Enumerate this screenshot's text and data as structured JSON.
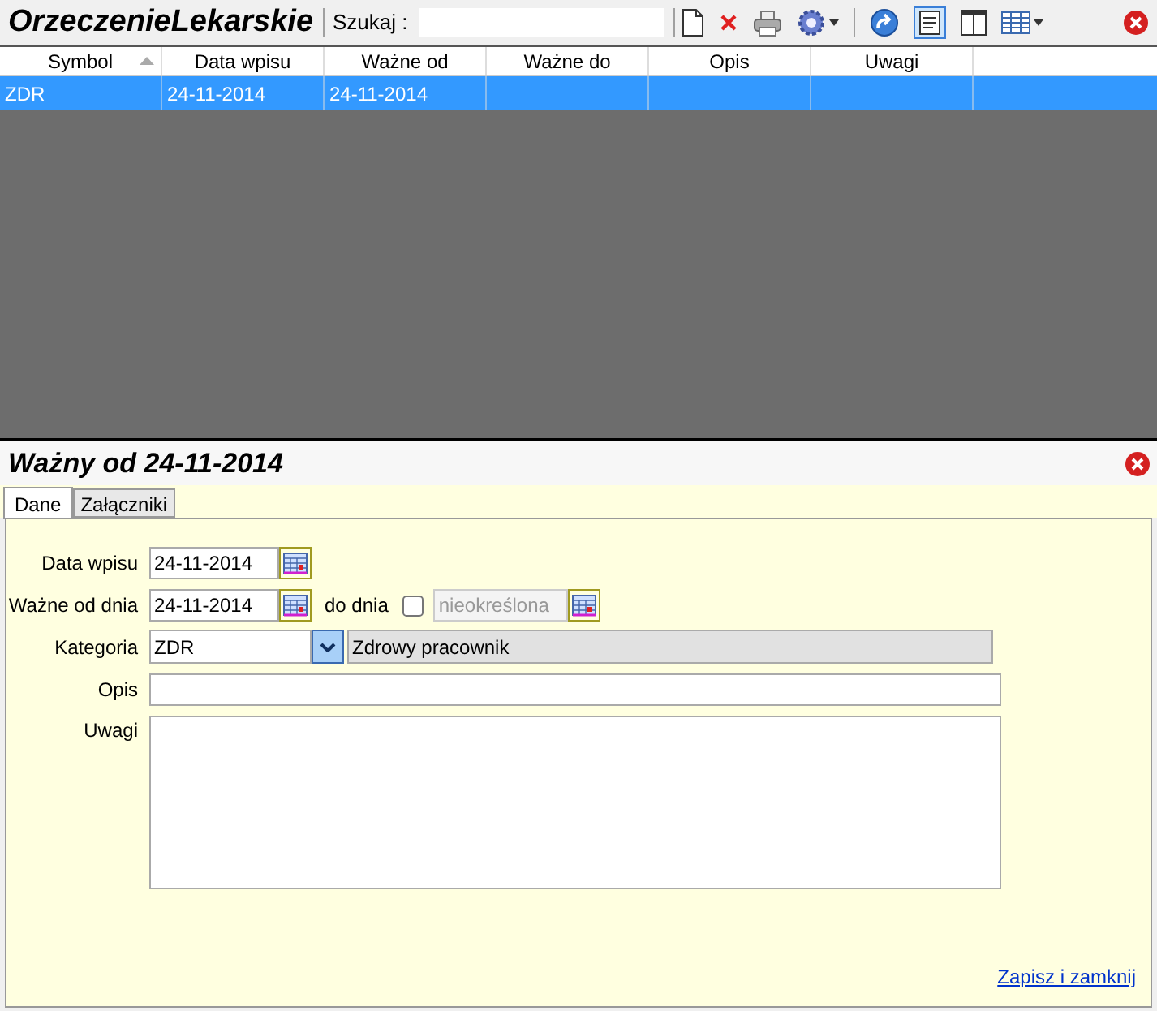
{
  "toolbar": {
    "title": "OrzeczenieLekarskie",
    "search_label": "Szukaj  :"
  },
  "table": {
    "columns": [
      {
        "label": "Symbol",
        "sorted": true
      },
      {
        "label": "Data wpisu",
        "sorted": false
      },
      {
        "label": "Ważne od",
        "sorted": false
      },
      {
        "label": "Ważne do",
        "sorted": false
      },
      {
        "label": "Opis",
        "sorted": false
      },
      {
        "label": "Uwagi",
        "sorted": false
      }
    ],
    "rows": [
      {
        "selected": true,
        "cells": [
          "ZDR",
          "24-11-2014",
          "24-11-2014",
          "",
          "",
          ""
        ]
      }
    ]
  },
  "detail": {
    "title": "Ważny od 24-11-2014",
    "tabs": [
      {
        "label": "Dane",
        "selected": true
      },
      {
        "label": "Załączniki",
        "selected": false
      }
    ],
    "form": {
      "data_wpisu": {
        "label": "Data wpisu",
        "value": "24-11-2014"
      },
      "wazne_od": {
        "label": "Ważne od dnia",
        "value": "24-11-2014"
      },
      "do_dnia": {
        "label": "do dnia",
        "checked": false,
        "value": "nieokreślona",
        "disabled": true
      },
      "kategoria": {
        "label": "Kategoria",
        "value": "ZDR",
        "description": "Zdrowy pracownik"
      },
      "opis": {
        "label": "Opis"
      },
      "uwagi": {
        "label": "Uwagi"
      }
    },
    "link": "Zapisz i zamknij"
  }
}
